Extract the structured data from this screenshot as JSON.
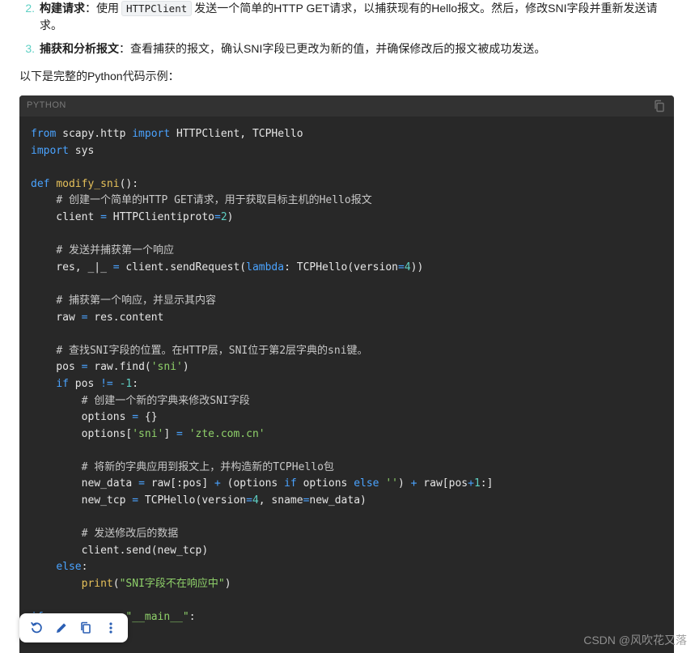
{
  "steps": [
    {
      "number": "2.",
      "title": "构建请求",
      "sep": "：使用",
      "code": "HTTPClient",
      "text": "发送一个简单的HTTP GET请求，以捕获现有的Hello报文。然后，修改SNI字段并重新发送请求。"
    },
    {
      "number": "3.",
      "title": "捕获和分析报文",
      "sep": "：",
      "text": "查看捕获的报文，确认SNI字段已更改为新的值，并确保修改后的报文被成功发送。"
    }
  ],
  "intro": "以下是完整的Python代码示例：",
  "codeblock": {
    "language": "PYTHON",
    "copy_icon": "copy-icon"
  },
  "toolbar": {
    "icons": [
      "refresh-icon",
      "edit-icon",
      "copy-icon",
      "more-vertical-icon"
    ]
  },
  "watermark": "CSDN @风吹花又落",
  "colors": {
    "code_bg": "#282828",
    "keyword": "#4aa3ff",
    "function": "#e6c15a",
    "string": "#8fd16a",
    "number": "#5fd0c4"
  }
}
